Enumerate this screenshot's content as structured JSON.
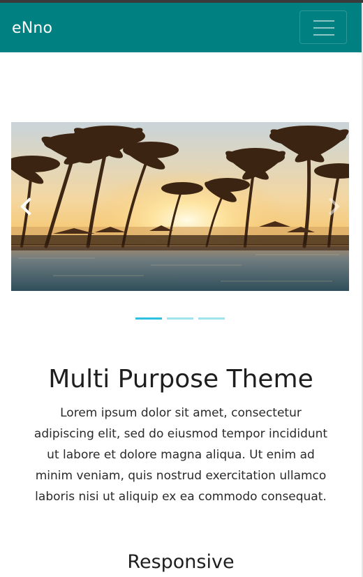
{
  "navbar": {
    "brand": "eNno",
    "toggle_icon": "hamburger-icon",
    "background": "#008080"
  },
  "carousel": {
    "prev_icon": "chevron-left-icon",
    "next_icon": "chevron-right-icon",
    "indicator_count": 3,
    "active_index": 0,
    "indicator_color": "#9fe3ef",
    "active_indicator_color": "#2ec0e0"
  },
  "content": {
    "title": "Multi Purpose Theme",
    "lead": "Lorem ipsum dolor sit amet, consectetur adipiscing elit, sed do eiusmod tempor incididunt ut labore et dolore magna aliqua. Ut enim ad minim veniam, quis nostrud exercitation ullamco laboris nisi ut aliquip ex ea commodo consequat.",
    "subtitle": "Responsive"
  }
}
